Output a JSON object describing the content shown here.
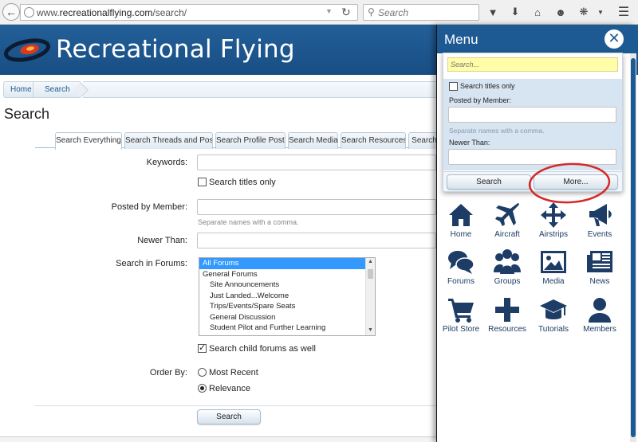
{
  "browser": {
    "url_prefix": "www.",
    "url_domain": "recreationalflying.com",
    "url_path": "/search/",
    "search_placeholder": "Search"
  },
  "site": {
    "title": "Recreational Flying"
  },
  "breadcrumb": {
    "home": "Home",
    "current": "Search"
  },
  "page": {
    "title": "Search"
  },
  "tabs": [
    "Search Everything",
    "Search Threads and Posts",
    "Search Profile Posts",
    "Search Media",
    "Search Resources",
    "Search"
  ],
  "form": {
    "keywords_label": "Keywords:",
    "titles_only_label": "Search titles only",
    "member_label": "Posted by Member:",
    "member_hint": "Separate names with a comma.",
    "newer_label": "Newer Than:",
    "forums_label": "Search in Forums:",
    "forums": [
      "All Forums",
      "General Forums",
      "Site Announcements",
      "Just Landed...Welcome",
      "Trips/Events/Spare Seats",
      "General Discussion",
      "Student Pilot and Further Learning"
    ],
    "child_forums_label": "Search child forums as well",
    "child_forums_checked": true,
    "order_label": "Order By:",
    "order_options": [
      "Most Recent",
      "Relevance"
    ],
    "order_selected": "Relevance",
    "search_button": "Search"
  },
  "menu": {
    "title": "Menu",
    "close": "✕",
    "quick_search": {
      "placeholder": "Search...",
      "titles_only_label": "Search titles only",
      "member_label": "Posted by Member:",
      "member_hint": "Separate names with a comma.",
      "newer_label": "Newer Than:",
      "search_button": "Search",
      "more_button": "More..."
    },
    "items": [
      {
        "label": "Home",
        "icon": "home-icon"
      },
      {
        "label": "Aircraft",
        "icon": "airplane-icon"
      },
      {
        "label": "Airstrips",
        "icon": "move-arrows-icon"
      },
      {
        "label": "Events",
        "icon": "megaphone-icon"
      },
      {
        "label": "Forums",
        "icon": "chat-bubbles-icon"
      },
      {
        "label": "Groups",
        "icon": "group-icon"
      },
      {
        "label": "Media",
        "icon": "picture-icon"
      },
      {
        "label": "News",
        "icon": "newspaper-icon"
      },
      {
        "label": "Pilot Store",
        "icon": "cart-icon"
      },
      {
        "label": "Resources",
        "icon": "plus-icon"
      },
      {
        "label": "Tutorials",
        "icon": "graduation-cap-icon"
      },
      {
        "label": "Members",
        "icon": "user-icon"
      }
    ]
  },
  "colors": {
    "brand_blue": "#1d5a93",
    "icon_navy": "#1d3c66",
    "annotation_red": "#d42a2a"
  }
}
